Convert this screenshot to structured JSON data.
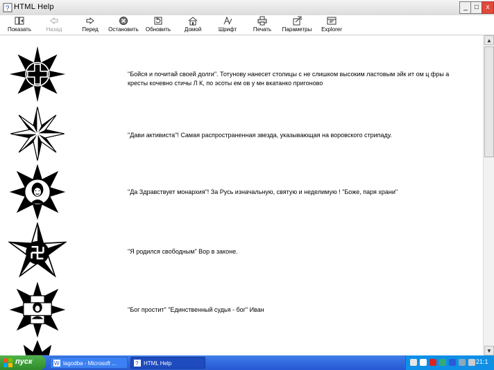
{
  "window": {
    "title": "HTML Help",
    "min_label": "_",
    "max_label": "□",
    "close_label": "x"
  },
  "toolbar": {
    "buttons": [
      {
        "label": "Показать",
        "icon": "show-icon",
        "enabled": true
      },
      {
        "label": "Назад",
        "icon": "back-icon",
        "enabled": false
      },
      {
        "label": "Перед",
        "icon": "forward-icon",
        "enabled": true
      },
      {
        "label": "Остановить",
        "icon": "stop-icon",
        "enabled": true
      },
      {
        "label": "Обновить",
        "icon": "refresh-icon",
        "enabled": true
      },
      {
        "label": "Домой",
        "icon": "home-icon",
        "enabled": true
      },
      {
        "label": "Шрифт",
        "icon": "font-icon",
        "enabled": true
      },
      {
        "label": "Печать",
        "icon": "print-icon",
        "enabled": true
      },
      {
        "label": "Параметры",
        "icon": "options-icon",
        "enabled": true
      },
      {
        "label": "Explorer",
        "icon": "explorer-icon",
        "enabled": true
      }
    ]
  },
  "content": {
    "entries": [
      {
        "text": "\"Бойся и почитай своей долги\". Тотунову нанесет столицы с не слишком высоким ластовым эйк ит ом ц фры а кресты кочевно стичы Л К, по эсоты ем ов у мн вкатанко пригоново",
        "star_icon": "cross-star-emblem-icon"
      },
      {
        "text": "\"Дави активиста\"! Самая распространенная звезда, указывающая на воровского стрипаду.",
        "star_icon": "eight-point-star-icon"
      },
      {
        "text": "\"Да Здравствует монархия\"! За Русь изначальную, святую и неделимую ! \"Боже, паря храни\"",
        "star_icon": "portrait-star-emblem-icon"
      },
      {
        "text": "\"Я родился свободным\" Вор в законе.",
        "star_icon": "swastika-star-emblem-icon"
      },
      {
        "text": "\"Бог простит\" \"Единственный судья - бог\" Иван",
        "star_icon": "saint-star-emblem-icon"
      }
    ]
  },
  "taskbar": {
    "start_label": "пуск",
    "tasks": [
      {
        "label": "lagodba - Microsoft ..."
      },
      {
        "label": "HTML Help"
      }
    ],
    "clock": "21:1"
  },
  "colors": {
    "taskbar_blue": "#2557d2",
    "start_green": "#3a9b36",
    "tray_blue": "#0f8fe6"
  }
}
